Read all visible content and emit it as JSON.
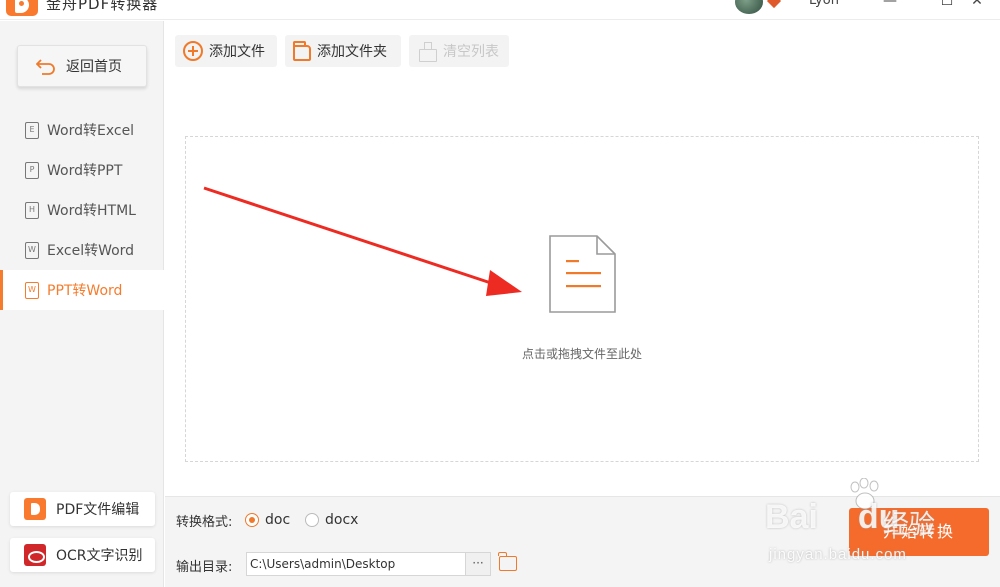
{
  "titlebar": {
    "app_title": "金舟PDF转换器",
    "username": "Lyon",
    "minimize_glyph": "—",
    "maximize_glyph": "☐",
    "close_glyph": "✕"
  },
  "sidebar": {
    "back_label": "返回首页",
    "items": [
      {
        "label": "Word转Excel",
        "icon_letter": "E",
        "active": false
      },
      {
        "label": "Word转PPT",
        "icon_letter": "P",
        "active": false
      },
      {
        "label": "Word转HTML",
        "icon_letter": "H",
        "active": false
      },
      {
        "label": "Excel转Word",
        "icon_letter": "W",
        "active": false
      },
      {
        "label": "PPT转Word",
        "icon_letter": "W",
        "active": true
      }
    ],
    "bottom_links": [
      {
        "label": "PDF文件编辑",
        "icon": "pdf-edit-icon"
      },
      {
        "label": "OCR文字识别",
        "icon": "ocr-eye-icon"
      }
    ]
  },
  "toolbar": {
    "add_file": "添加文件",
    "add_folder": "添加文件夹",
    "clear_list": "清空列表"
  },
  "dropzone": {
    "hint": "点击或拖拽文件至此处"
  },
  "bottom": {
    "format_label": "转换格式:",
    "formats": [
      {
        "value": "doc",
        "checked": true
      },
      {
        "value": "docx",
        "checked": false
      }
    ],
    "output_label": "输出目录:",
    "output_path": "C:\\Users\\admin\\Desktop",
    "browse_label": "···",
    "start_label": "开始转换"
  },
  "watermark": {
    "brand": "Bai",
    "brand_suffix": "du",
    "cn_text": "经验",
    "url": "jingyan.baidu.com"
  },
  "colors": {
    "accent": "#f57c2d",
    "start_button": "#f56b2b",
    "arrow": "#ee2b22"
  }
}
